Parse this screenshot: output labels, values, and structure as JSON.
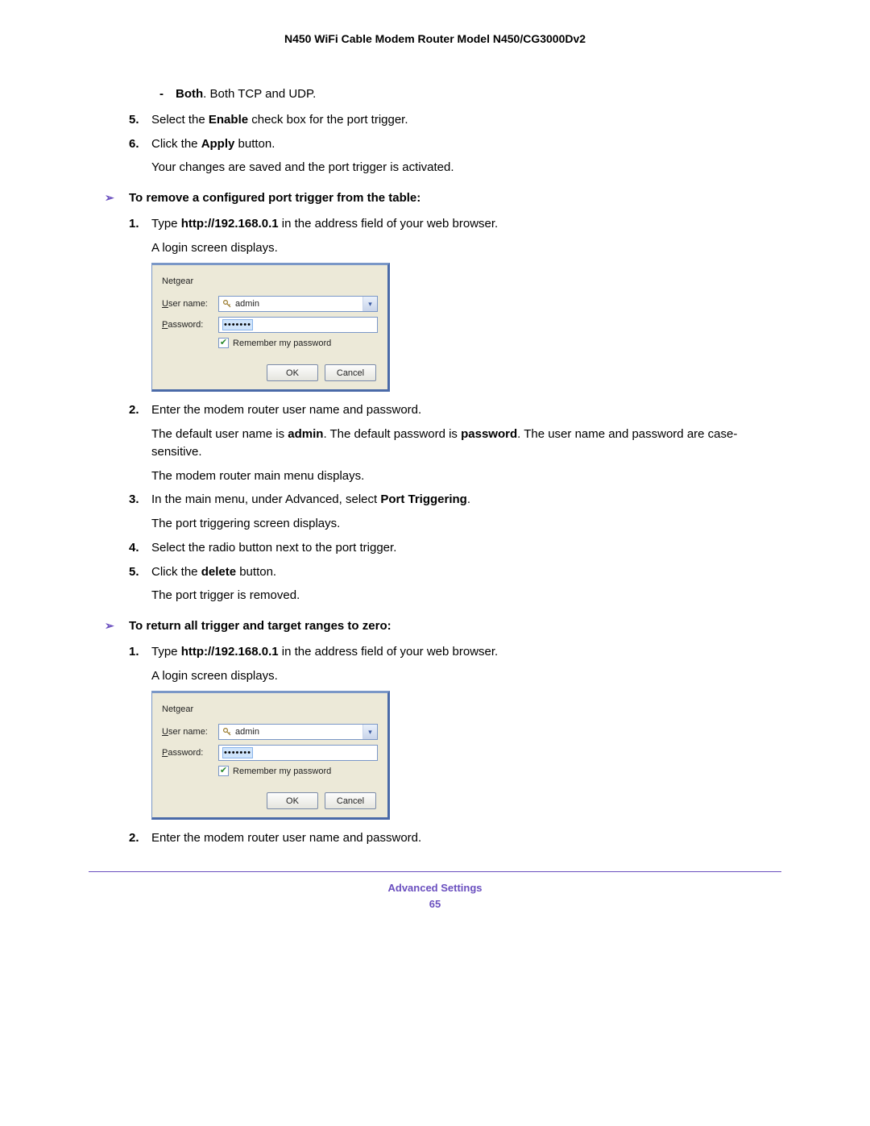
{
  "header": {
    "title": "N450 WiFi Cable Modem Router Model N450/CG3000Dv2"
  },
  "bullet_both": {
    "dash": "-",
    "label": "Both",
    "desc": ". Both TCP and UDP."
  },
  "step5a": {
    "num": "5.",
    "pre": "Select the ",
    "bold": "Enable",
    "post": " check box for the port trigger."
  },
  "step6a": {
    "num": "6.",
    "pre": "Click the ",
    "bold": "Apply",
    "post": " button."
  },
  "step6a_cont": "Your changes are saved and the port trigger is activated.",
  "heading_remove": {
    "arrow": "➢",
    "text": "To remove a configured port trigger from the table:"
  },
  "r1": {
    "num": "1.",
    "pre": "Type ",
    "bold": "http://192.168.0.1",
    "post": " in the address field of your web browser."
  },
  "r1_cont": "A login screen displays.",
  "login": {
    "realm": "Netgear",
    "user_label_u": "U",
    "user_label_rest": "ser name:",
    "user_value": "admin",
    "pass_label_p": "P",
    "pass_label_rest": "assword:",
    "pass_mask": "•••••••",
    "remember_r": "R",
    "remember_rest": "emember my password",
    "ok": "OK",
    "cancel": "Cancel"
  },
  "r2": {
    "num": "2.",
    "text": "Enter the modem router user name and password."
  },
  "r2_cont_a_pre": "The default user name is ",
  "r2_cont_a_b1": "admin",
  "r2_cont_a_mid": ". The default password is ",
  "r2_cont_a_b2": "password",
  "r2_cont_a_post": ". The user name and password are case-sensitive.",
  "r2_cont_b": "The modem router main menu displays.",
  "r3": {
    "num": "3.",
    "pre": "In the main menu, under Advanced, select ",
    "bold": "Port Triggering",
    "post": "."
  },
  "r3_cont": "The port triggering screen displays.",
  "r4": {
    "num": "4.",
    "text": "Select the radio button next to the port trigger."
  },
  "r5": {
    "num": "5.",
    "pre": "Click the ",
    "bold": "delete",
    "post": " button."
  },
  "r5_cont": "The port trigger is removed.",
  "heading_return": {
    "arrow": "➢",
    "text": "To return all trigger and target ranges to zero:"
  },
  "z1": {
    "num": "1.",
    "pre": "Type ",
    "bold": "http://192.168.0.1",
    "post": " in the address field of your web browser."
  },
  "z1_cont": "A login screen displays.",
  "z2": {
    "num": "2.",
    "text": "Enter the modem router user name and password."
  },
  "footer": {
    "section": "Advanced Settings",
    "page": "65"
  }
}
